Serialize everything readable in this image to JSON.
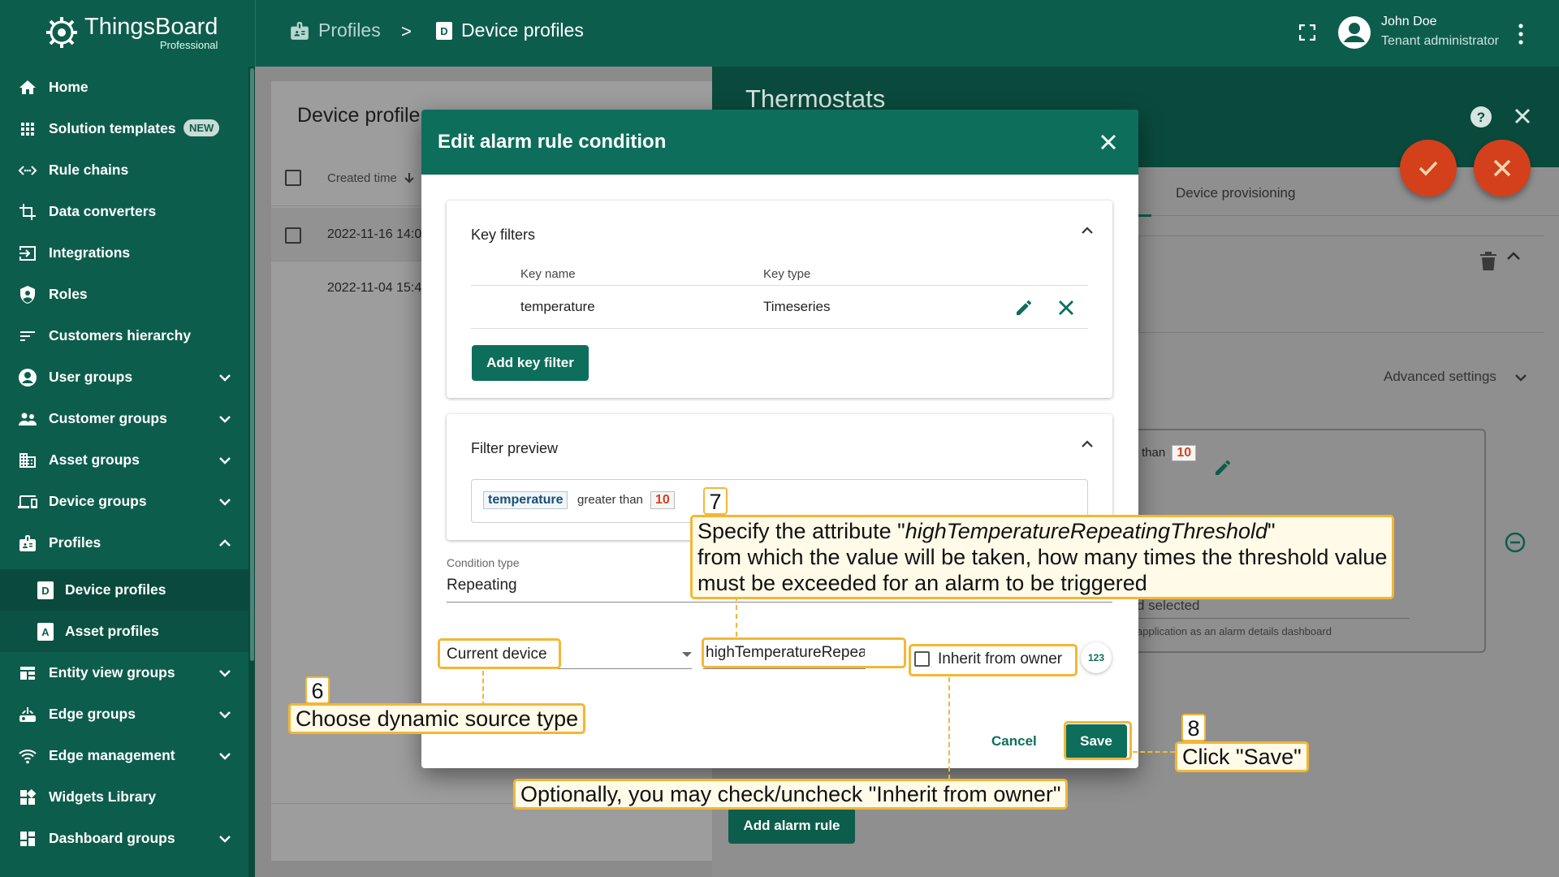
{
  "app": {
    "logo_name": "ThingsBoard",
    "logo_sub": "Professional"
  },
  "breadcrumb": {
    "item1": "Profiles",
    "separator": ">",
    "item2": "Device profiles"
  },
  "user": {
    "name": "John Doe",
    "role": "Tenant administrator"
  },
  "sidebar": {
    "items": [
      {
        "label": "Home",
        "icon": "home-icon"
      },
      {
        "label": "Solution templates",
        "icon": "grid-icon",
        "badge": "NEW"
      },
      {
        "label": "Rule chains",
        "icon": "code-icon"
      },
      {
        "label": "Data converters",
        "icon": "transform-icon"
      },
      {
        "label": "Integrations",
        "icon": "input-icon"
      },
      {
        "label": "Roles",
        "icon": "shield-icon"
      },
      {
        "label": "Customers hierarchy",
        "icon": "sort-icon"
      },
      {
        "label": "User groups",
        "icon": "account-icon"
      },
      {
        "label": "Customer groups",
        "icon": "people-icon"
      },
      {
        "label": "Asset groups",
        "icon": "domain-icon"
      },
      {
        "label": "Device groups",
        "icon": "devices-icon"
      },
      {
        "label": "Profiles",
        "icon": "badge-icon"
      },
      {
        "label": "Device profiles",
        "icon": "device-profile-icon"
      },
      {
        "label": "Asset profiles",
        "icon": "asset-profile-icon"
      },
      {
        "label": "Entity view groups",
        "icon": "view-icon"
      },
      {
        "label": "Edge groups",
        "icon": "router-icon"
      },
      {
        "label": "Edge management",
        "icon": "wifi-icon"
      },
      {
        "label": "Widgets Library",
        "icon": "widgets-icon"
      },
      {
        "label": "Dashboard groups",
        "icon": "dashboard-icon"
      }
    ]
  },
  "list": {
    "title": "Device profile",
    "column_created": "Created time",
    "rows": [
      "2022-11-16 14:0",
      "2022-11-04 15:4"
    ]
  },
  "detail": {
    "title": "Thermostats",
    "tab": "Device provisioning",
    "advanced": "Advanced settings",
    "than": "than",
    "value": "10",
    "rd_selected": "d selected",
    "rd_hint": "application as an alarm details dashboard",
    "add_alarm_rule": "Add alarm rule"
  },
  "dialog": {
    "title": "Edit alarm rule condition",
    "key_filters": {
      "title": "Key filters",
      "col_name": "Key name",
      "col_type": "Key type",
      "row_name": "temperature",
      "row_type": "Timeseries",
      "add_button": "Add key filter"
    },
    "filter_preview": {
      "title": "Filter preview",
      "key": "temperature",
      "operation": "greater than",
      "value": "10"
    },
    "condition_type": {
      "label": "Condition type",
      "value": "Repeating"
    },
    "source": {
      "value": "Current device"
    },
    "attribute": {
      "value": "highTemperatureRepeating"
    },
    "inherit_label": "Inherit from owner",
    "number_toggle": "123",
    "cancel": "Cancel",
    "save": "Save"
  },
  "annotations": {
    "step6_num": "6",
    "step6_text": "Choose dynamic source type",
    "step7_num": "7",
    "step7_line1_pre": "Specify the attribute \"",
    "step7_line1_attr": "highTemperatureRepeatingThreshold",
    "step7_line1_post": "\"",
    "step7_line2": "from which the value will be taken, how many times the threshold value",
    "step7_line3": "must be exceeded for an alarm to be triggered",
    "step8_num": "8",
    "step8_text": "Click \"Save\"",
    "inherit_text": "Optionally, you may check/uncheck \"Inherit from owner\""
  },
  "colors": {
    "brand": "#0d5d4d",
    "accent": "#d4401c",
    "annotation": "#f3b736"
  }
}
